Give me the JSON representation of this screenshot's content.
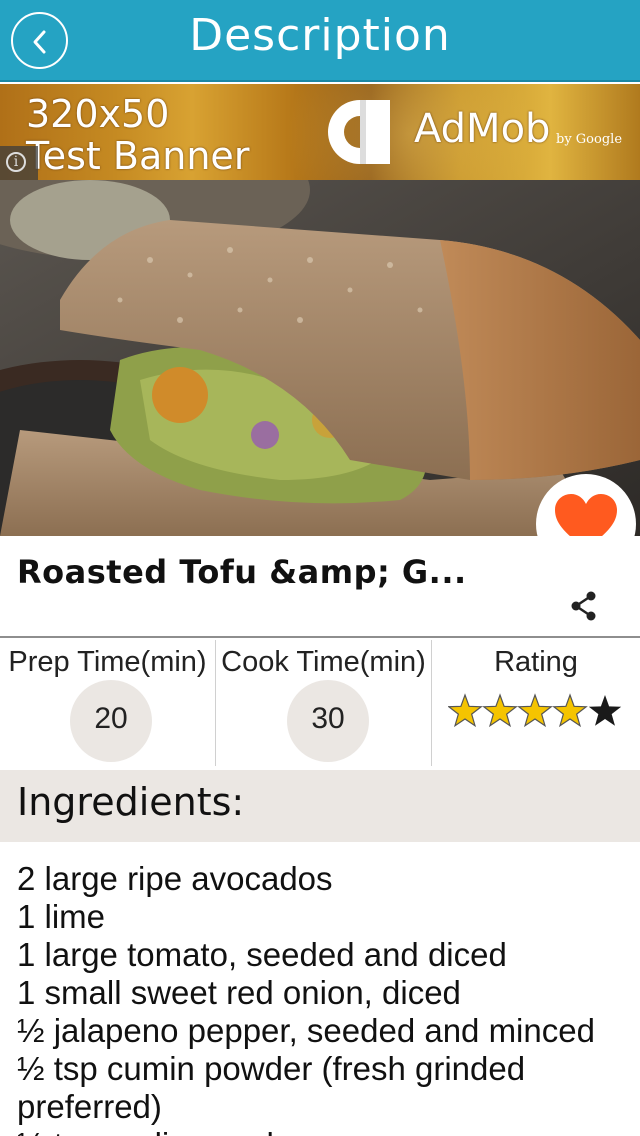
{
  "header": {
    "title": "Description",
    "back_icon": "chevron-left-icon",
    "color": "#25a3c3"
  },
  "ad": {
    "line1": "320x50",
    "line2": "Test Banner",
    "brand": "AdMob",
    "by": "by Google",
    "info_icon": "info-icon"
  },
  "recipe": {
    "title": "Roasted Tofu &amp; G...",
    "favorite_icon": "heart-icon",
    "favorite_color": "#ff5a1f",
    "share_icon": "share-icon"
  },
  "stats": {
    "prep": {
      "label": "Prep Time(min)",
      "value": "20"
    },
    "cook": {
      "label": "Cook Time(min)",
      "value": "30"
    },
    "rating": {
      "label": "Rating",
      "stars": 4,
      "max": 5,
      "filled_color": "#f5c400",
      "empty_color": "#1a1a1a"
    }
  },
  "ingredients": {
    "title": "Ingredients:",
    "items": [
      "2 large ripe avocados",
      "1 lime",
      "1 large tomato, seeded and diced",
      "1 small sweet red onion, diced",
      "½ jalapeno pepper, seeded and minced",
      "½ tsp cumin powder (fresh grinded",
      "preferred)",
      "½ tsp garlic powder"
    ]
  }
}
